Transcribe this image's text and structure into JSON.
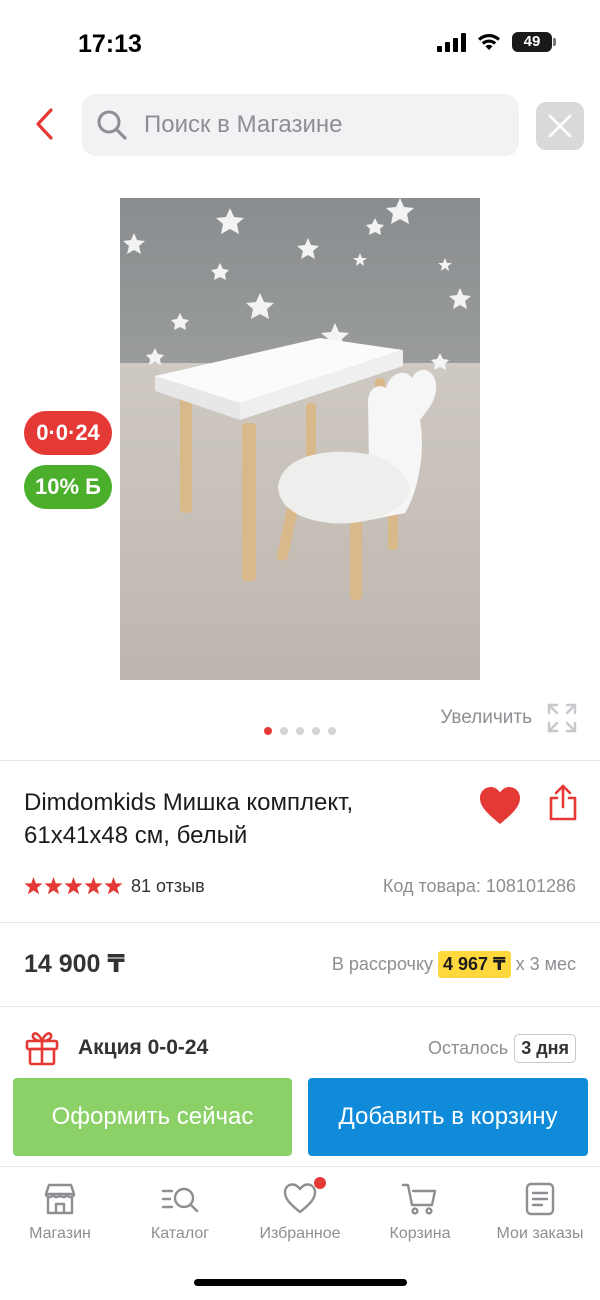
{
  "status_bar": {
    "time": "17:13",
    "battery": "49"
  },
  "search": {
    "placeholder": "Поиск в Магазине"
  },
  "product": {
    "badge_installment": "0·0·24",
    "badge_bonus": "10% Б",
    "zoom_label": "Увеличить",
    "image_count": 5,
    "active_image": 1,
    "title": "Dimdomkids Мишка комплект, 61x41x48 см, белый",
    "rating": 5,
    "reviews": "81 отзыв",
    "code": "Код товара: 108101286",
    "price": "14 900 ₸",
    "installment_prefix": "В рассрочку",
    "installment_amount": "4 967 ₸",
    "installment_suffix": "x 3 мес"
  },
  "promo": {
    "label": "Акция 0-0-24",
    "remaining_label": "Осталось",
    "days": "3 дня"
  },
  "actions": {
    "buy_now": "Оформить сейчас",
    "add_to_cart": "Добавить в корзину"
  },
  "tabs": [
    {
      "label": "Магазин",
      "icon": "shop-icon"
    },
    {
      "label": "Каталог",
      "icon": "catalog-search-icon"
    },
    {
      "label": "Избранное",
      "icon": "heart-outline-icon"
    },
    {
      "label": "Корзина",
      "icon": "cart-icon"
    },
    {
      "label": "Мои заказы",
      "icon": "orders-icon"
    }
  ],
  "colors": {
    "accent_red": "#e53935",
    "green_badge": "#4caf2c",
    "buy_button": "#8bd168",
    "cart_button": "#0f8bd9",
    "installment_highlight": "#ffd83d"
  }
}
